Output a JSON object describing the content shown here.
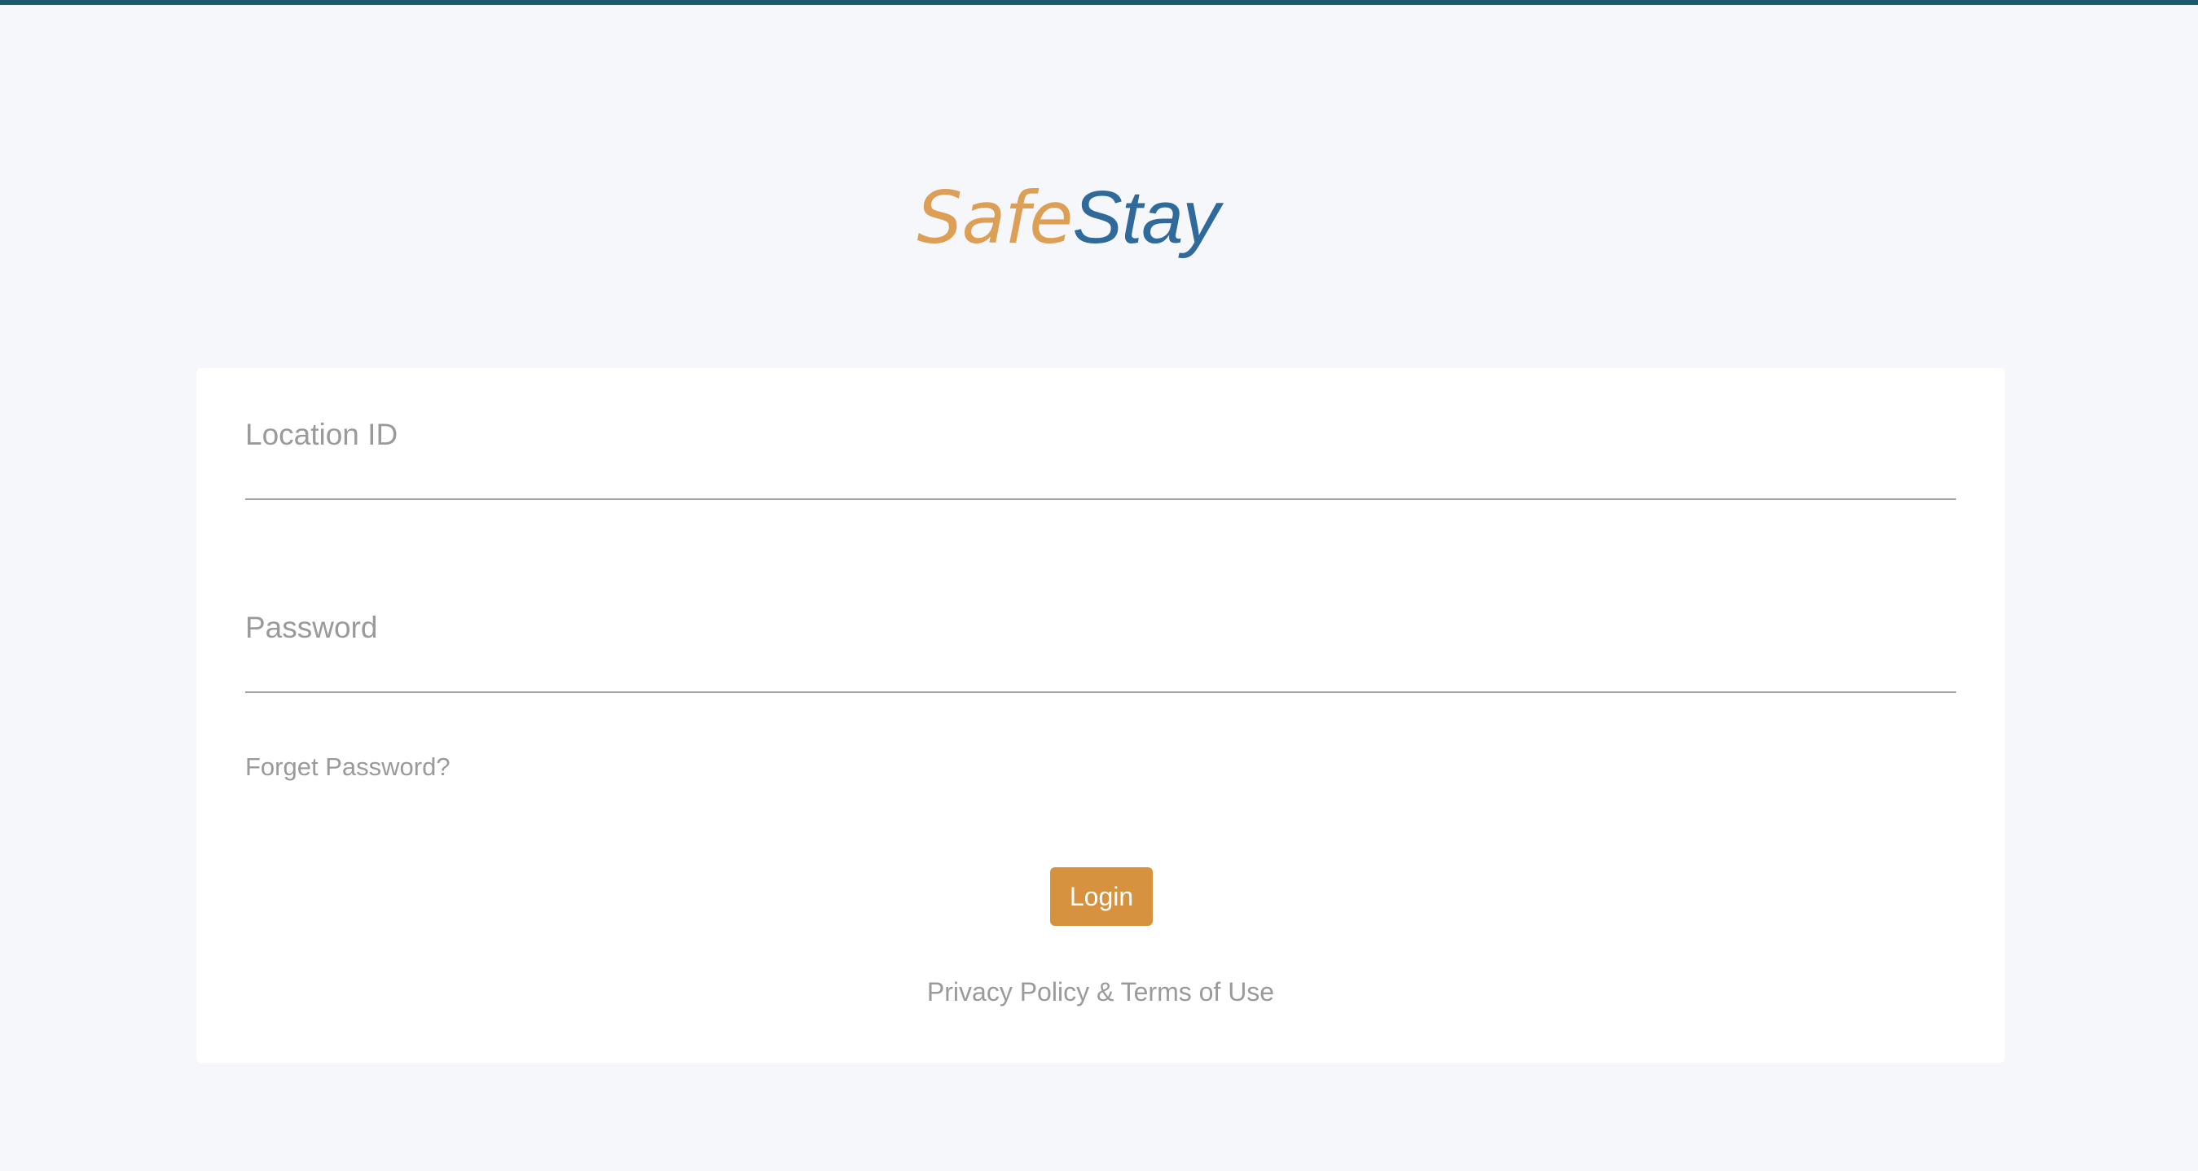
{
  "brand": {
    "logo_part1": "Safe",
    "logo_part2": "Stay",
    "accent_color": "#dc9a4e",
    "primary_color": "#2f6a9a",
    "top_bar_color": "#1b5a6e"
  },
  "login_form": {
    "location_label": "Location ID",
    "location_value": "",
    "password_label": "Password",
    "password_value": "",
    "forgot_link": "Forget Password?",
    "login_button": "Login",
    "legal_link": "Privacy Policy & Terms of Use"
  }
}
